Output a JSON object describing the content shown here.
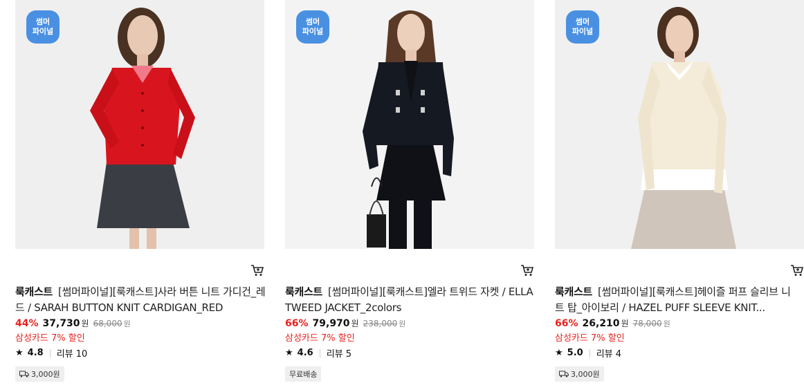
{
  "products": [
    {
      "badge_line1": "썸머",
      "badge_line2": "파이널",
      "brand": "룩캐스트",
      "name": "[썸머파이널][룩캐스트]사라 버튼 니트 가디건_레드 / SARAH BUTTON KNIT CARDIGAN_RED",
      "discount": "44%",
      "sale_price": "37,730",
      "sale_unit": "원",
      "original_price": "68,000",
      "original_unit": "원",
      "promo": "삼성카드 7% 할인",
      "rating": "4.8",
      "review_label": "리뷰 10",
      "shipping": "3,000원",
      "shipping_icon": "truck-icon",
      "colors": {
        "garment": "#d8151e",
        "skirt": "#3a3d44",
        "inner": "#f07a8a"
      }
    },
    {
      "badge_line1": "썸머",
      "badge_line2": "파이널",
      "brand": "룩캐스트",
      "name": "[썸머파이널][룩캐스트]엘라 트위드 자켓 / ELLA TWEED JACKET_2colors",
      "discount": "66%",
      "sale_price": "79,970",
      "sale_unit": "원",
      "original_price": "238,000",
      "original_unit": "원",
      "promo": "삼성카드 7% 할인",
      "rating": "4.6",
      "review_label": "리뷰 5",
      "shipping": "무료배송",
      "shipping_icon": "",
      "colors": {
        "garment": "#151922",
        "skirt": "#0f1117",
        "inner": "#0f1117"
      }
    },
    {
      "badge_line1": "썸머",
      "badge_line2": "파이널",
      "brand": "룩캐스트",
      "name": "[썸머파이널][룩캐스트]헤이즐 퍼프 슬리브 니트 탑_아이보리 / HAZEL PUFF SLEEVE KNIT...",
      "discount": "66%",
      "sale_price": "26,210",
      "sale_unit": "원",
      "original_price": "78,000",
      "original_unit": "원",
      "promo": "삼성카드 7% 할인",
      "rating": "5.0",
      "review_label": "리뷰 4",
      "shipping": "3,000원",
      "shipping_icon": "truck-icon",
      "colors": {
        "garment": "#f4ecd9",
        "skirt": "#cfc5bb",
        "inner": "#ffffff"
      }
    }
  ],
  "theme": {
    "badge_color": "#4a90e2",
    "discount_color": "#e8221f"
  }
}
